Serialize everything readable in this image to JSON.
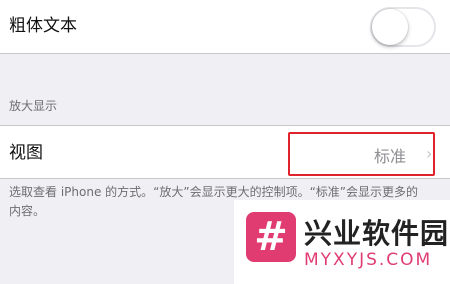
{
  "bold_text": {
    "label": "粗体文本",
    "enabled": false
  },
  "zoom_section": {
    "header": "放大显示"
  },
  "view": {
    "label": "视图",
    "value": "标准",
    "chevron": "›"
  },
  "footer_text": "选取查看 iPhone 的方式。“放大”会显示更大的控制项。“标准”会显示更多的内容。",
  "watermark": {
    "logo_glyph": "#",
    "title": "兴业软件园",
    "subtitle": "MYXYJS.COM"
  },
  "colors": {
    "highlight": "#e0222a",
    "watermark_accent": "#e03c72"
  }
}
